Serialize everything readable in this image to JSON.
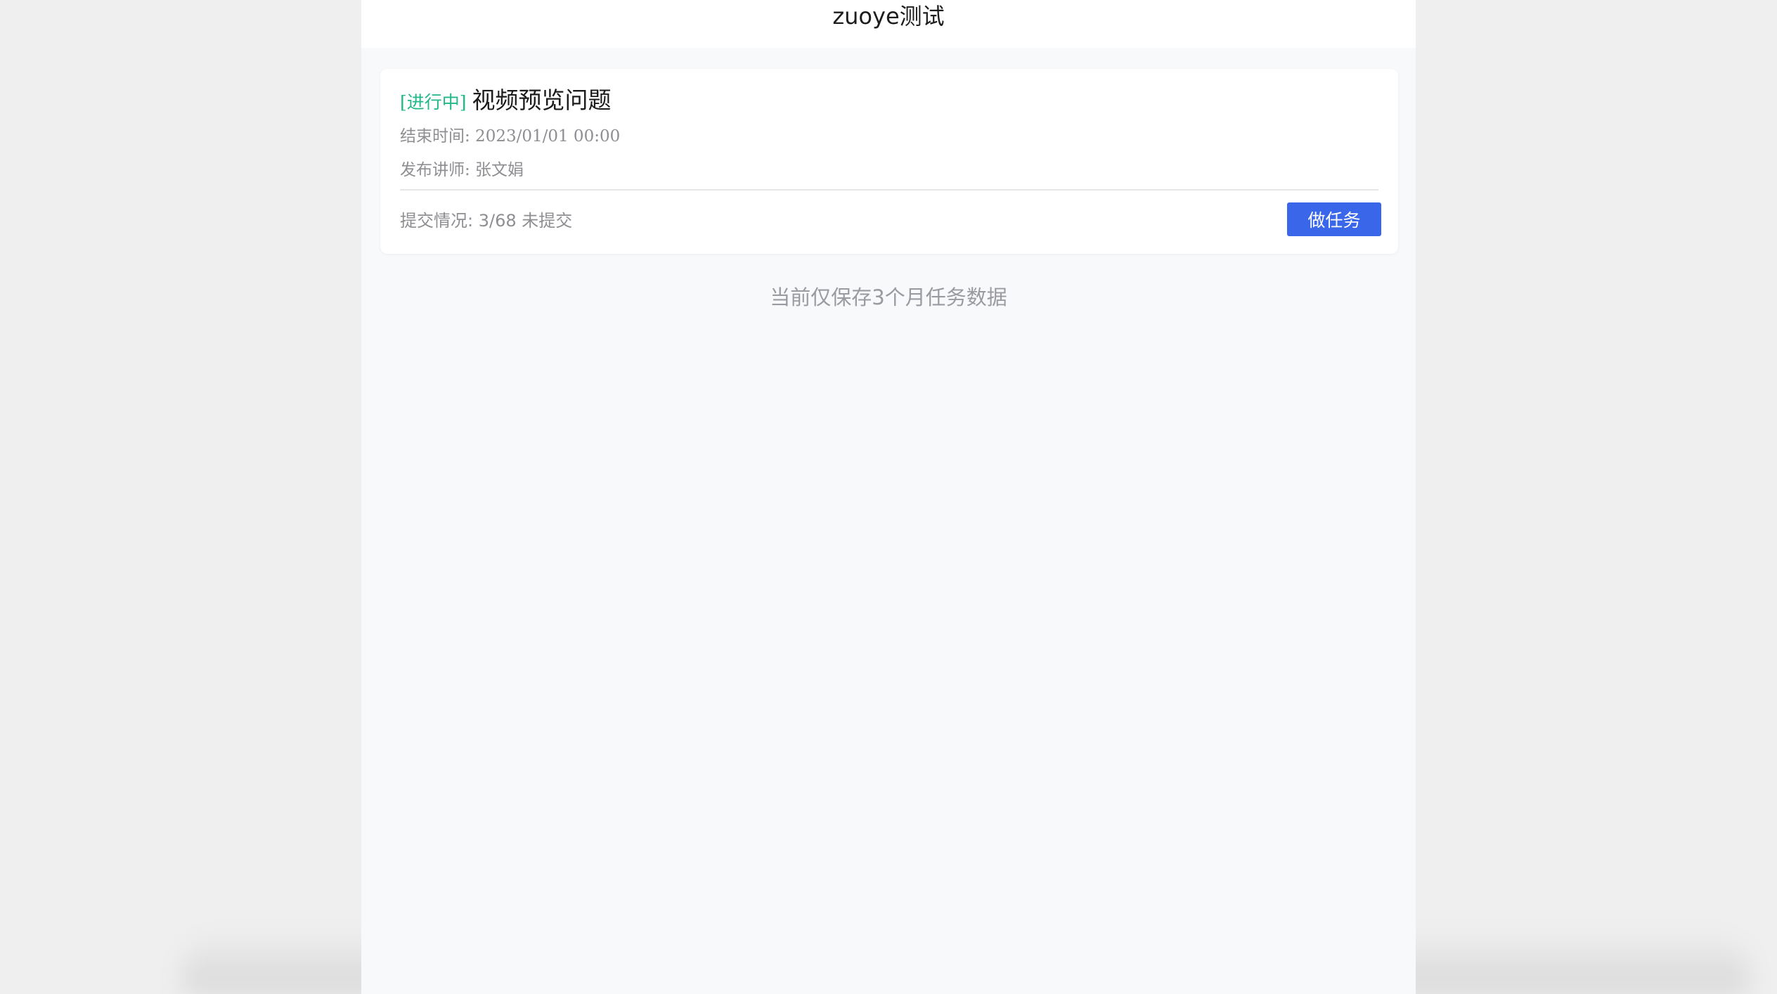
{
  "header": {
    "title": "zuoye测试"
  },
  "task_card": {
    "status": "[进行中]",
    "title": "视频预览问题",
    "end_time": "结束时间: 2023/01/01 00:00",
    "teacher": "发布讲师: 张文娟",
    "submit_status": "提交情况: 3/68 未提交",
    "action_label": "做任务"
  },
  "notice": "当前仅保存3个月任务数据",
  "colors": {
    "status_green": "#20b889",
    "button_blue": "#3a66ea"
  }
}
